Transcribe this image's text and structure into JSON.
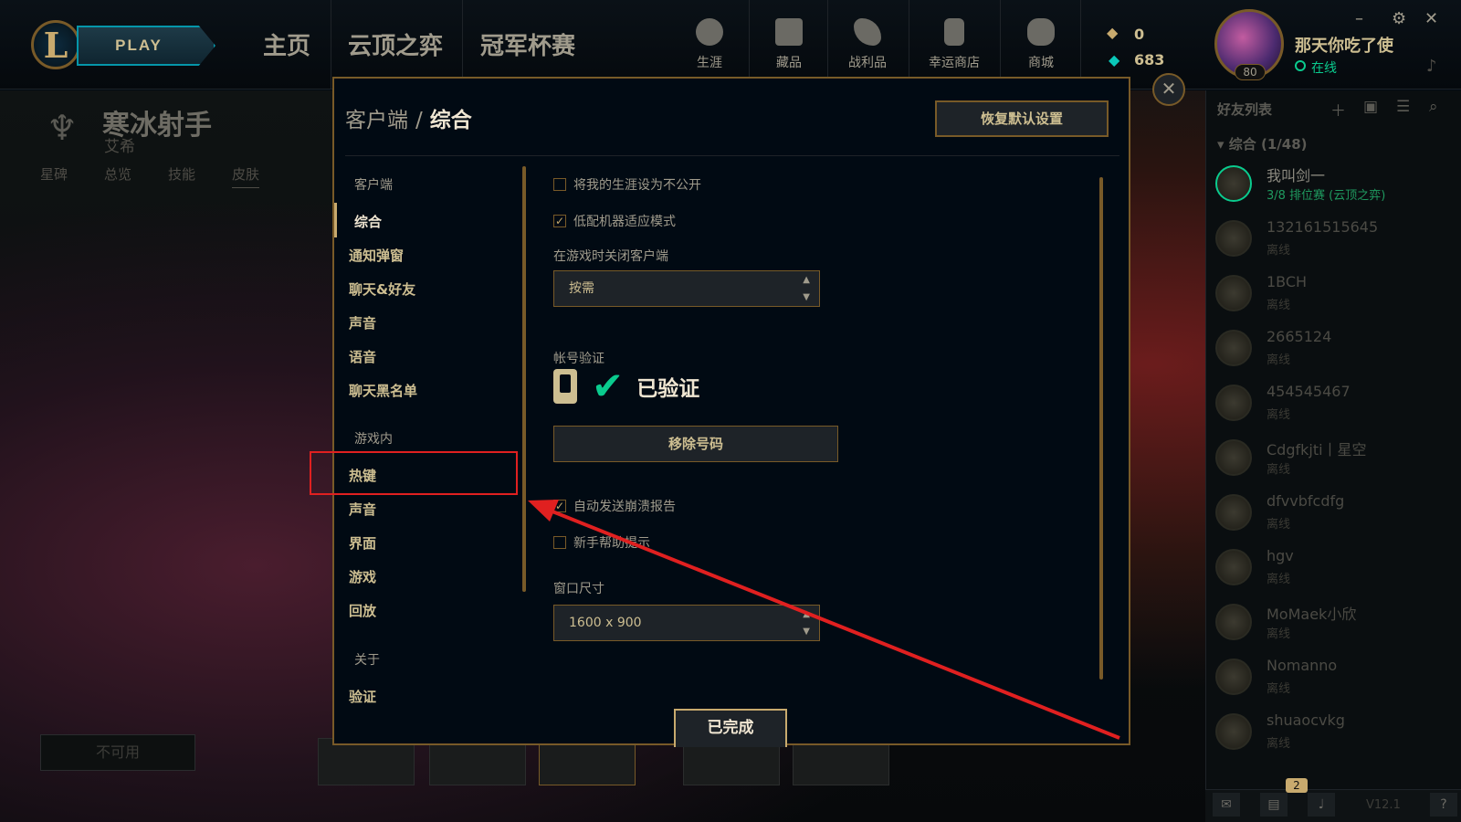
{
  "topnav": {
    "play_label": "PLAY",
    "tabs": [
      "主页",
      "云顶之弈",
      "冠军杯赛"
    ],
    "icons": [
      {
        "name": "profile",
        "label": "生涯"
      },
      {
        "name": "collection",
        "label": "藏品"
      },
      {
        "name": "loot",
        "label": "战利品"
      },
      {
        "name": "lucky-store",
        "label": "幸运商店"
      },
      {
        "name": "store",
        "label": "商城"
      }
    ],
    "currency_rp": "0",
    "currency_be": "683",
    "profile": {
      "name": "那天你吃了使",
      "status": "在线",
      "level": "80"
    },
    "window_controls": [
      "–",
      "⚙",
      "✕"
    ]
  },
  "champion": {
    "name": "寒冰射手",
    "subtitle": "艾希",
    "tabs": [
      "星碑",
      "总览",
      "技能",
      "皮肤"
    ],
    "unavailable_label": "不可用"
  },
  "modal": {
    "breadcrumb_root": "客户端",
    "breadcrumb_sep": "/",
    "breadcrumb_current": "综合",
    "restore_label": "恢复默认设置",
    "sidebar": {
      "client_header": "客户端",
      "client_items": [
        "综合",
        "通知弹窗",
        "聊天&好友",
        "声音",
        "语音",
        "聊天黑名单"
      ],
      "ingame_header": "游戏内",
      "ingame_items": [
        "热键",
        "声音",
        "界面",
        "游戏",
        "回放"
      ],
      "about_header": "关于",
      "about_items": [
        "验证"
      ]
    },
    "options": {
      "private_career": {
        "label": "将我的生涯设为不公开",
        "checked": false
      },
      "low_spec": {
        "label": "低配机器适应模式",
        "checked": true
      },
      "close_client_label": "在游戏时关闭客户端",
      "close_client_value": "按需",
      "account_verify_label": "帐号验证",
      "verified_text": "已验证",
      "remove_number_label": "移除号码",
      "crash_report": {
        "label": "自动发送崩溃报告",
        "checked": true
      },
      "tutorial_tips": {
        "label": "新手帮助提示",
        "checked": false
      },
      "window_size_label": "窗口尺寸",
      "window_size_value": "1600 x 900"
    },
    "done_label": "已完成"
  },
  "friends": {
    "title": "好友列表",
    "group_label": "综合 (1/48)",
    "list": [
      {
        "name": "我叫剑一",
        "status": "3/8 排位赛 (云顶之弈)",
        "online": true
      },
      {
        "name": "132161515645",
        "status": "离线",
        "online": false
      },
      {
        "name": "1BCH",
        "status": "离线",
        "online": false
      },
      {
        "name": "2665124",
        "status": "离线",
        "online": false
      },
      {
        "name": "454545467",
        "status": "离线",
        "online": false
      },
      {
        "name": "Cdgfkjti丨星空",
        "status": "离线",
        "online": false
      },
      {
        "name": "dfvvbfcdfg",
        "status": "离线",
        "online": false
      },
      {
        "name": "hgv",
        "status": "离线",
        "online": false
      },
      {
        "name": "MoMaek小欣",
        "status": "离线",
        "online": false
      },
      {
        "name": "Nomanno",
        "status": "离线",
        "online": false
      },
      {
        "name": "shuaocvkg",
        "status": "离线",
        "online": false
      }
    ],
    "notification_count": "2",
    "version": "V12.1"
  }
}
